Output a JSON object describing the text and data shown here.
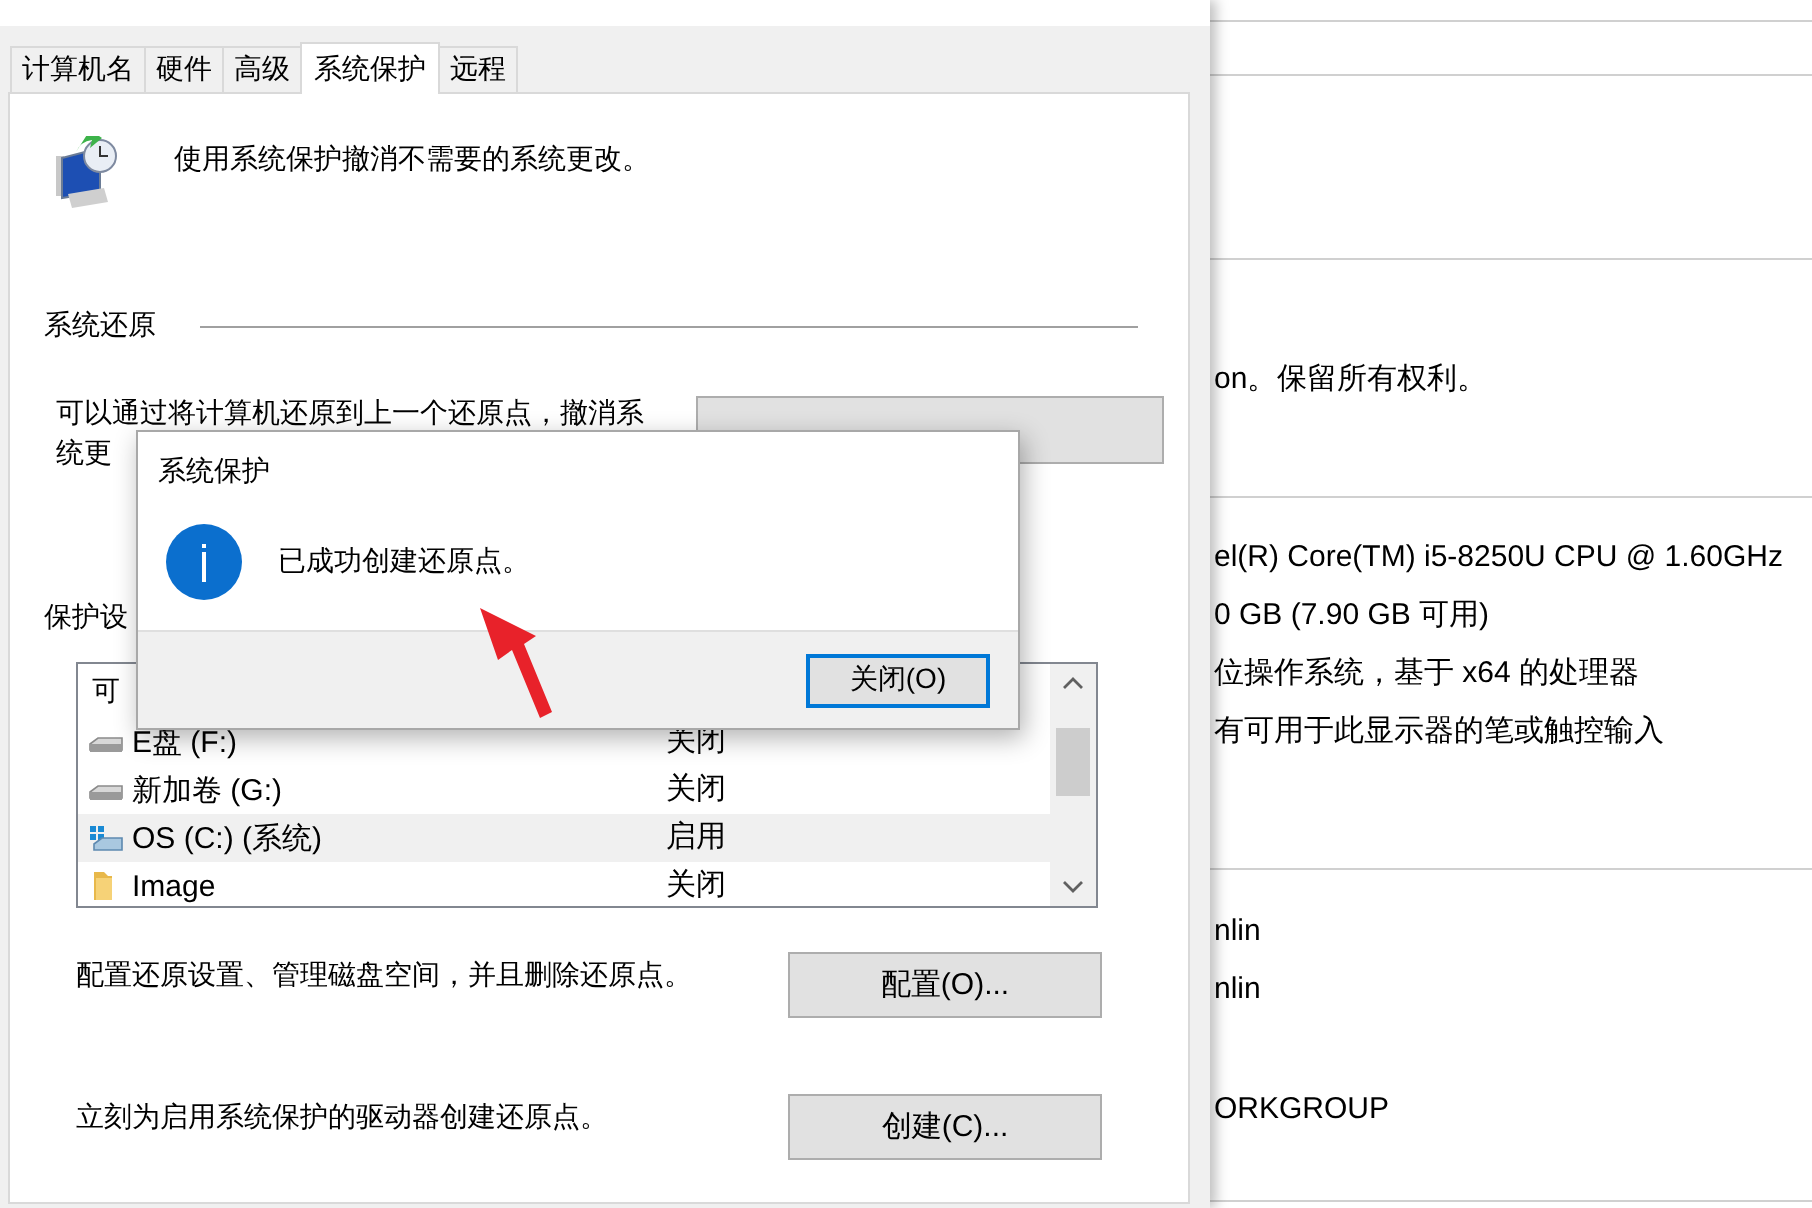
{
  "tabs": [
    {
      "label": "计算机名",
      "selected": false
    },
    {
      "label": "硬件",
      "selected": false
    },
    {
      "label": "高级",
      "selected": false
    },
    {
      "label": "系统保护",
      "selected": true
    },
    {
      "label": "远程",
      "selected": false
    }
  ],
  "intro": "使用系统保护撤消不需要的系统更改。",
  "restore_section": {
    "title": "系统还原",
    "description_lines": [
      "可以通过将计算机还原到上一个还原点，撤消系",
      "统更"
    ]
  },
  "protection_section": {
    "title": "保护设",
    "columns": [
      "可"
    ],
    "drives": [
      {
        "name": "E盘 (F:)",
        "status": "关闭",
        "kind": "drive",
        "selected": false
      },
      {
        "name": "新加卷 (G:)",
        "status": "关闭",
        "kind": "drive",
        "selected": false
      },
      {
        "name": "OS (C:) (系统)",
        "status": "启用",
        "kind": "system",
        "selected": true
      },
      {
        "name": "Image",
        "status": "关闭",
        "kind": "folder",
        "selected": false
      }
    ]
  },
  "actions": [
    {
      "description": "配置还原设置、管理磁盘空间，并且删除还原点。",
      "button": "配置(O)..."
    },
    {
      "description": "立刻为启用系统保护的驱动器创建还原点。",
      "button": "创建(C)..."
    }
  ],
  "dialog": {
    "title": "系统保护",
    "message": "已成功创建还原点。",
    "button": "关闭(O)"
  },
  "background_window": {
    "sections": [
      {
        "lines": [
          "on。保留所有权利。"
        ]
      },
      {
        "lines": [
          "el(R) Core(TM) i5-8250U CPU @ 1.60GHz",
          "0 GB (7.90 GB 可用)",
          "位操作系统，基于 x64 的处理器",
          "有可用于此显示器的笔或触控输入"
        ]
      },
      {
        "lines": [
          "nlin",
          "nlin",
          "ORKGROUP"
        ]
      }
    ]
  }
}
